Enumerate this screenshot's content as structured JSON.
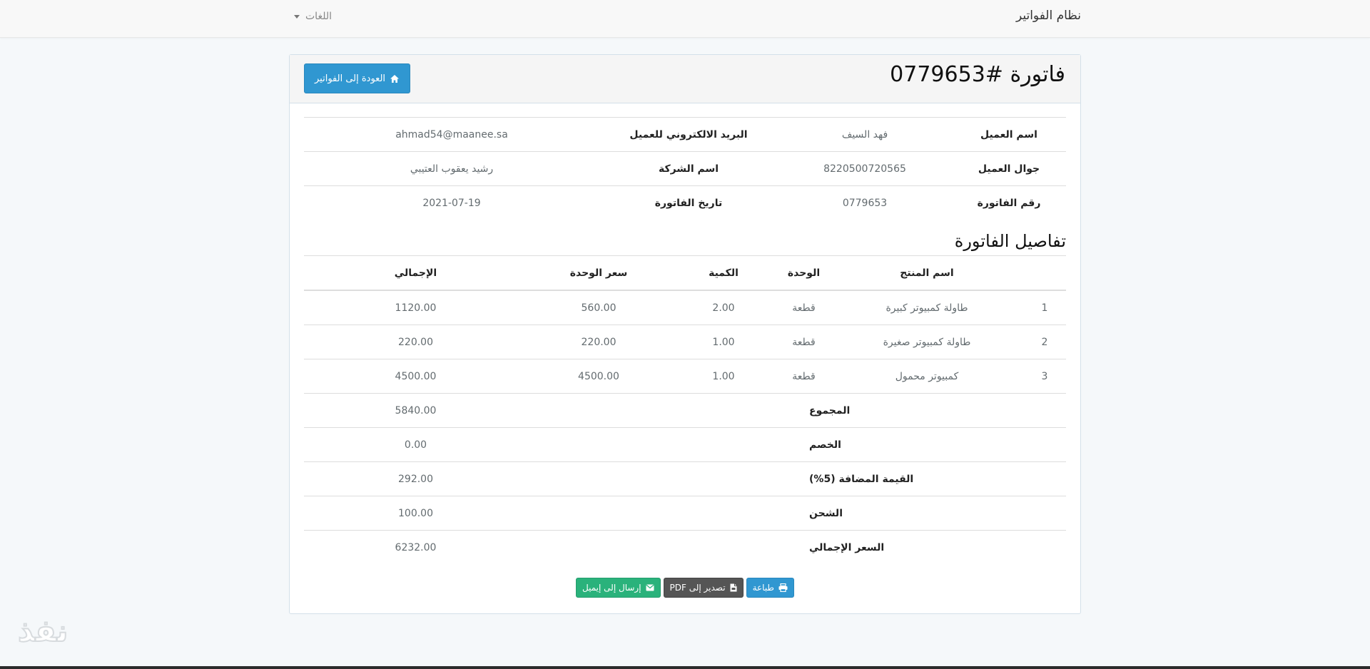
{
  "navbar": {
    "brand": "نظام الفواتير",
    "languages_label": "اللغات"
  },
  "invoice": {
    "title": "فاتورة #0779653",
    "back_label": "العودة إلى الفواتير",
    "info_rows": [
      {
        "label1": "اسم العميل",
        "value1": "فهد السيف",
        "label2": "البريد الالكتروني للعميل",
        "value2": "ahmad54@maanee.sa"
      },
      {
        "label1": "جوال العميل",
        "value1": "8220500720565",
        "label2": "اسم الشركة",
        "value2": "رشيد يعقوب العتيبي"
      },
      {
        "label1": "رقم الفاتورة",
        "value1": "0779653",
        "label2": "تاريخ الفاتورة",
        "value2": "2021-07-19"
      }
    ],
    "details_title": "تفاصيل الفاتورة",
    "columns": {
      "num": "",
      "product": "اسم المنتج",
      "unit": "الوحدة",
      "qty": "الكمية",
      "price": "سعر الوحدة",
      "total": "الإجمالي"
    },
    "items": [
      {
        "num": "1",
        "product": "طاولة كمبيوتر كبيرة",
        "unit": "قطعة",
        "qty": "2.00",
        "price": "560.00",
        "total": "1120.00"
      },
      {
        "num": "2",
        "product": "طاولة كمبيوتر صغيرة",
        "unit": "قطعة",
        "qty": "1.00",
        "price": "220.00",
        "total": "220.00"
      },
      {
        "num": "3",
        "product": "كمبيوتر محمول",
        "unit": "قطعة",
        "qty": "1.00",
        "price": "4500.00",
        "total": "4500.00"
      }
    ],
    "summary": [
      {
        "label": "المجموع",
        "value": "5840.00"
      },
      {
        "label": "الخصم",
        "value": "0.00"
      },
      {
        "label": "القيمة المضافة (5%)",
        "value": "292.00"
      },
      {
        "label": "الشحن",
        "value": "100.00"
      },
      {
        "label": "السعر الإجمالي",
        "value": "6232.00"
      }
    ],
    "actions": {
      "print": "طباعة",
      "pdf": "تصدير إلى PDF",
      "email": "إرسال إلى إيميل"
    }
  },
  "watermark": "نفذ",
  "colors": {
    "primary": "#3097d1",
    "success": "#2ab27b",
    "dark": "#555555"
  }
}
